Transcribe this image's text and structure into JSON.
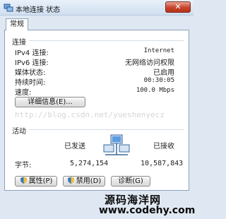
{
  "window": {
    "title": "本地连接 状态",
    "close_glyph": "✕"
  },
  "tab": {
    "label": "常规"
  },
  "connection": {
    "heading": "连接",
    "rows": [
      {
        "label": "IPv4 连接:",
        "value": "Internet"
      },
      {
        "label": "IPv6 连接:",
        "value": "无网络访问权限"
      },
      {
        "label": "媒体状态:",
        "value": "已启用"
      },
      {
        "label": "持续时间:",
        "value": "00:30:05"
      },
      {
        "label": "速度:",
        "value": "100.0 Mbps"
      }
    ],
    "details_button": "详细信息(E)..."
  },
  "watermark_url": "http://blog.csdn.net/yueshenyecz",
  "activity": {
    "heading": "活动",
    "sent_label": "已发送",
    "received_label": "已接收",
    "bytes_label": "字节:",
    "bytes_sent": "5,274,154",
    "bytes_received": "10,587,843"
  },
  "buttons": {
    "properties": "属性(P)",
    "disable": "禁用(D)",
    "diagnose": "诊断(G)"
  },
  "site_watermark": {
    "line1": "源码海洋网",
    "line2": "www.codehy.com"
  },
  "colors": {
    "accent": "#2b6ab0",
    "close_red": "#c7442d",
    "shield_blue": "#3a74c4",
    "shield_yellow": "#f2c230"
  },
  "icons": [
    "network-icon",
    "close-icon",
    "computer-network-icon",
    "shield-icon"
  ]
}
